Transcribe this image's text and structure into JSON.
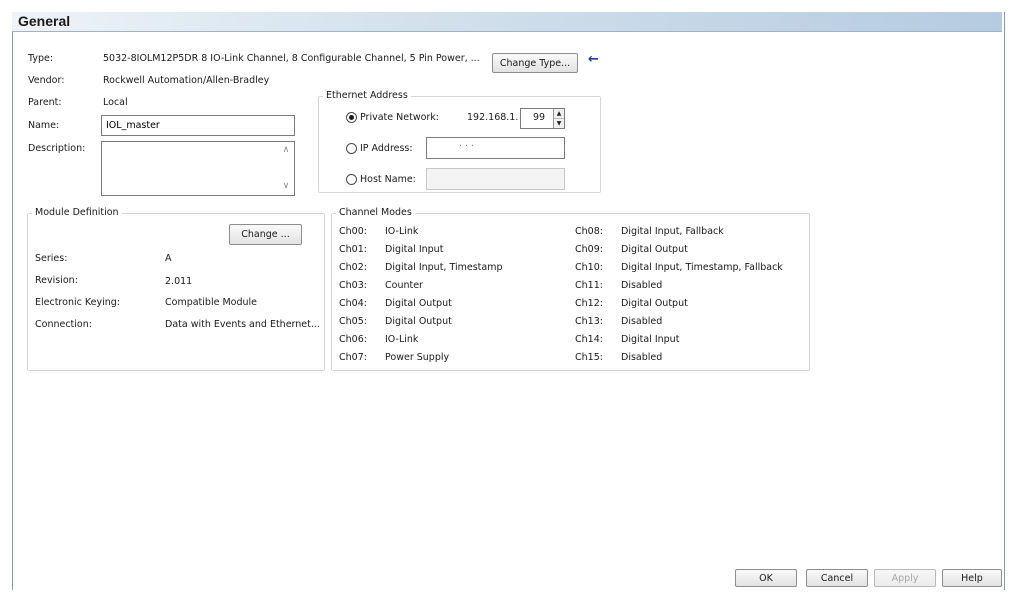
{
  "header": {
    "title": "General"
  },
  "general": {
    "type_label": "Type:",
    "type_value": "5032-8IOLM12P5DR 8 IO-Link Channel, 8 Configurable Channel, 5 Pin Power, ...",
    "change_type_button": "Change Type...",
    "vendor_label": "Vendor:",
    "vendor_value": "Rockwell Automation/Allen-Bradley",
    "parent_label": "Parent:",
    "parent_value": "Local",
    "name_label": "Name:",
    "name_value": "IOL_master",
    "description_label": "Description:",
    "description_value": ""
  },
  "ethernet": {
    "title": "Ethernet Address",
    "private_label": "Private Network:",
    "private_prefix": "192.168.1.",
    "private_octet": "99",
    "ip_label": "IP Address:",
    "ip_dots": "·      ·      ·",
    "host_label": "Host Name:",
    "selected": "Private Network"
  },
  "module_definition": {
    "title": "Module Definition",
    "change_button": "Change ...",
    "rows": [
      {
        "label": "Series:",
        "value": "A"
      },
      {
        "label": "Revision:",
        "value": "2.011"
      },
      {
        "label": "Electronic Keying:",
        "value": "Compatible Module"
      },
      {
        "label": "Connection:",
        "value": "Data with Events and Ethernet..."
      }
    ]
  },
  "channel_modes": {
    "title": "Channel Modes",
    "left": [
      {
        "ch": "Ch00:",
        "mode": "IO-Link"
      },
      {
        "ch": "Ch01:",
        "mode": "Digital Input"
      },
      {
        "ch": "Ch02:",
        "mode": "Digital Input, Timestamp"
      },
      {
        "ch": "Ch03:",
        "mode": "Counter"
      },
      {
        "ch": "Ch04:",
        "mode": "Digital Output"
      },
      {
        "ch": "Ch05:",
        "mode": "Digital Output"
      },
      {
        "ch": "Ch06:",
        "mode": "IO-Link"
      },
      {
        "ch": "Ch07:",
        "mode": "Power Supply"
      }
    ],
    "right": [
      {
        "ch": "Ch08:",
        "mode": "Digital Input, Fallback"
      },
      {
        "ch": "Ch09:",
        "mode": "Digital Output"
      },
      {
        "ch": "Ch10:",
        "mode": "Digital Input, Timestamp, Fallback"
      },
      {
        "ch": "Ch11:",
        "mode": "Disabled"
      },
      {
        "ch": "Ch12:",
        "mode": "Digital Output"
      },
      {
        "ch": "Ch13:",
        "mode": "Disabled"
      },
      {
        "ch": "Ch14:",
        "mode": "Digital Input"
      },
      {
        "ch": "Ch15:",
        "mode": "Disabled"
      }
    ]
  },
  "footer": {
    "ok": "OK",
    "cancel": "Cancel",
    "apply": "Apply",
    "help": "Help"
  },
  "icons": {
    "pointer_arrow": "left-arrow-icon"
  },
  "colors": {
    "accent_arrow": "#1f3f8f",
    "header_gradient_end": "#b5cbe0"
  }
}
